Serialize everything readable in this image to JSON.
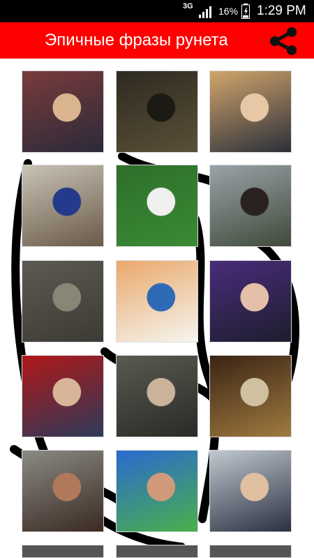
{
  "status_bar": {
    "network": "3G",
    "battery": "16%",
    "time": "1:29 PM"
  },
  "app_bar": {
    "title": "Эпичные фразы рунета"
  },
  "thumbnails": [
    {
      "name": "thumb-tv-host-audience",
      "colors": [
        "#7a3b3b",
        "#2a2a3a",
        "#d9b48f"
      ]
    },
    {
      "name": "thumb-dark-wizard",
      "colors": [
        "#2e2a20",
        "#5a5038",
        "#1b1a14"
      ]
    },
    {
      "name": "thumb-street-interview-couple",
      "colors": [
        "#d2a56b",
        "#2b2f3a",
        "#e6c7a6"
      ]
    },
    {
      "name": "thumb-old-man-interview",
      "colors": [
        "#c9c3b6",
        "#6a5a48",
        "#243a8a"
      ]
    },
    {
      "name": "thumb-football-field",
      "colors": [
        "#2e6f2a",
        "#3a8a35",
        "#f0f0f0"
      ]
    },
    {
      "name": "thumb-young-man-park",
      "colors": [
        "#9aa3a8",
        "#3f4a3a",
        "#2a2220"
      ]
    },
    {
      "name": "thumb-shooter-game",
      "colors": [
        "#5c5a52",
        "#3c3a34",
        "#8a8676"
      ]
    },
    {
      "name": "thumb-cartoon-family",
      "colors": [
        "#eaa86a",
        "#f5f5f0",
        "#2f6ab6"
      ]
    },
    {
      "name": "thumb-news-presenter",
      "colors": [
        "#4a2c7a",
        "#1d1d2e",
        "#e4c0a8"
      ]
    },
    {
      "name": "thumb-politician-red",
      "colors": [
        "#b01818",
        "#2d3a5a",
        "#d8b498"
      ]
    },
    {
      "name": "thumb-crowd-speaker",
      "colors": [
        "#5a5a52",
        "#2a2a26",
        "#c9b39a"
      ]
    },
    {
      "name": "thumb-wizard-staff",
      "colors": [
        "#3a2414",
        "#a07a40",
        "#d0c0a0"
      ]
    },
    {
      "name": "thumb-spartan-shout",
      "colors": [
        "#8a8a84",
        "#3a2a22",
        "#b07a5a"
      ]
    },
    {
      "name": "thumb-wrestler-cap",
      "colors": [
        "#2a6ad0",
        "#4ab04a",
        "#d09a7a"
      ]
    },
    {
      "name": "thumb-officials-press",
      "colors": [
        "#c0c8d0",
        "#2a3040",
        "#e0c0a0"
      ]
    }
  ]
}
